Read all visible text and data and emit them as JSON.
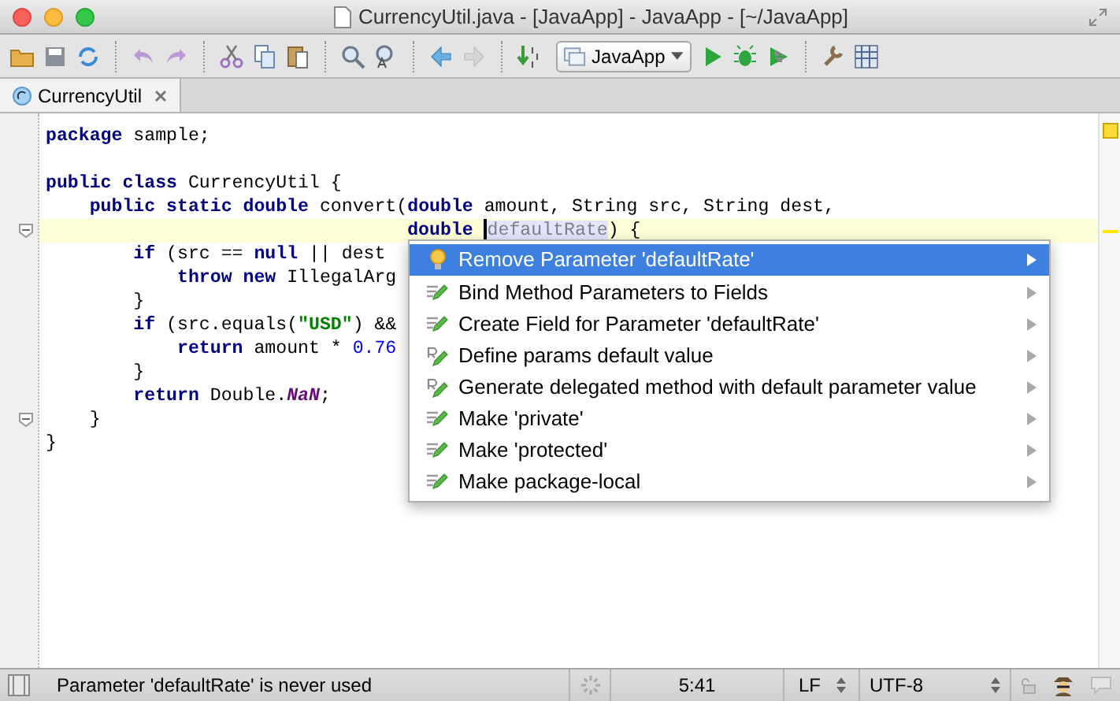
{
  "window": {
    "title": "CurrencyUtil.java - [JavaApp] - JavaApp - [~/JavaApp]"
  },
  "toolbar": {
    "run_config": "JavaApp"
  },
  "tabs": [
    {
      "label": "CurrencyUtil",
      "selected": true
    }
  ],
  "editor": {
    "lines": [
      {
        "kind": "code",
        "tokens": [
          {
            "text": "package",
            "kind": "kw"
          },
          {
            "text": " sample;",
            "kind": "plain"
          }
        ]
      },
      {
        "kind": "blank"
      },
      {
        "kind": "code",
        "tokens": [
          {
            "text": "public class",
            "kind": "kw"
          },
          {
            "text": " CurrencyUtil {",
            "kind": "plain"
          }
        ]
      },
      {
        "kind": "code",
        "tokens": [
          {
            "text": "    public static double",
            "kind": "kw"
          },
          {
            "text": " convert(",
            "kind": "plain"
          },
          {
            "text": "double",
            "kind": "kw"
          },
          {
            "text": " amount, String src, String dest,",
            "kind": "plain"
          }
        ]
      },
      {
        "kind": "code",
        "tokens": [
          {
            "text": "                                 double ",
            "kind": "kw"
          },
          {
            "text": "defaultRate",
            "kind": "unused"
          },
          {
            "text": ") {",
            "kind": "plain"
          }
        ]
      },
      {
        "kind": "code",
        "tokens": [
          {
            "text": "        if",
            "kind": "kw"
          },
          {
            "text": " (src == ",
            "kind": "plain"
          },
          {
            "text": "null",
            "kind": "kw"
          },
          {
            "text": " || dest",
            "kind": "plain"
          }
        ]
      },
      {
        "kind": "code",
        "tokens": [
          {
            "text": "            throw new",
            "kind": "kw"
          },
          {
            "text": " IllegalArg",
            "kind": "plain"
          }
        ]
      },
      {
        "kind": "code",
        "tokens": [
          {
            "text": "        }",
            "kind": "plain"
          }
        ]
      },
      {
        "kind": "code",
        "tokens": [
          {
            "text": "        if",
            "kind": "kw"
          },
          {
            "text": " (src.equals(",
            "kind": "plain"
          },
          {
            "text": "\"USD\"",
            "kind": "str"
          },
          {
            "text": ") &&",
            "kind": "plain"
          }
        ]
      },
      {
        "kind": "code",
        "tokens": [
          {
            "text": "            return",
            "kind": "kw"
          },
          {
            "text": " amount * ",
            "kind": "plain"
          },
          {
            "text": "0.76",
            "kind": "num"
          }
        ]
      },
      {
        "kind": "code",
        "tokens": [
          {
            "text": "        }",
            "kind": "plain"
          }
        ]
      },
      {
        "kind": "code",
        "tokens": [
          {
            "text": "        return",
            "kind": "kw"
          },
          {
            "text": " Double.",
            "kind": "plain"
          },
          {
            "text": "NaN",
            "kind": "const"
          },
          {
            "text": ";",
            "kind": "plain"
          }
        ]
      },
      {
        "kind": "code",
        "tokens": [
          {
            "text": "    }",
            "kind": "plain"
          }
        ]
      },
      {
        "kind": "code",
        "tokens": [
          {
            "text": "}",
            "kind": "plain"
          }
        ]
      }
    ]
  },
  "popup": {
    "items": [
      {
        "label": "Remove Parameter 'defaultRate'",
        "kind": "bulb",
        "selected": true
      },
      {
        "label": "Bind Method Parameters to Fields",
        "kind": "intention",
        "selected": false
      },
      {
        "label": "Create Field for Parameter 'defaultRate'",
        "kind": "intention",
        "selected": false
      },
      {
        "label": "Define params default value",
        "kind": "refactor",
        "selected": false
      },
      {
        "label": "Generate delegated method with default parameter value",
        "kind": "refactor",
        "selected": false
      },
      {
        "label": "Make 'private'",
        "kind": "intention",
        "selected": false
      },
      {
        "label": "Make 'protected'",
        "kind": "intention",
        "selected": false
      },
      {
        "label": "Make package-local",
        "kind": "intention",
        "selected": false
      }
    ]
  },
  "status_bar": {
    "message": "Parameter 'defaultRate' is never used",
    "position": "5:41",
    "line_separator": "LF",
    "encoding": "UTF-8"
  }
}
